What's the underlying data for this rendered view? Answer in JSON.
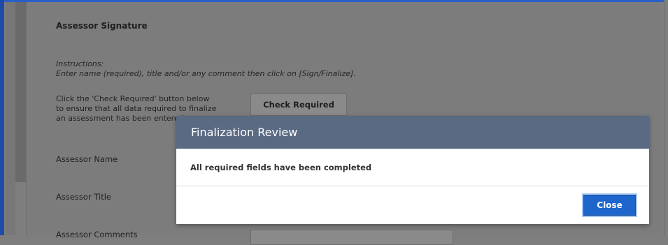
{
  "section": {
    "title": "Assessor Signature",
    "instructions_label": "Instructions:",
    "instructions_text": "Enter name (required), title and/or any comment then click on [Sign/Finalize].",
    "check_help": "Click the 'Check Required' button below to ensure that all data required to finalize an assessment has been entered.",
    "check_button": "Check Required",
    "fields": {
      "name": "Assessor Name",
      "title": "Assessor Title",
      "comments": "Assessor Comments"
    }
  },
  "modal": {
    "title": "Finalization Review",
    "message": "All required fields have been completed",
    "close_button": "Close"
  },
  "colors": {
    "modal_header": "#5a6a83",
    "close_button": "#1e66cc"
  }
}
